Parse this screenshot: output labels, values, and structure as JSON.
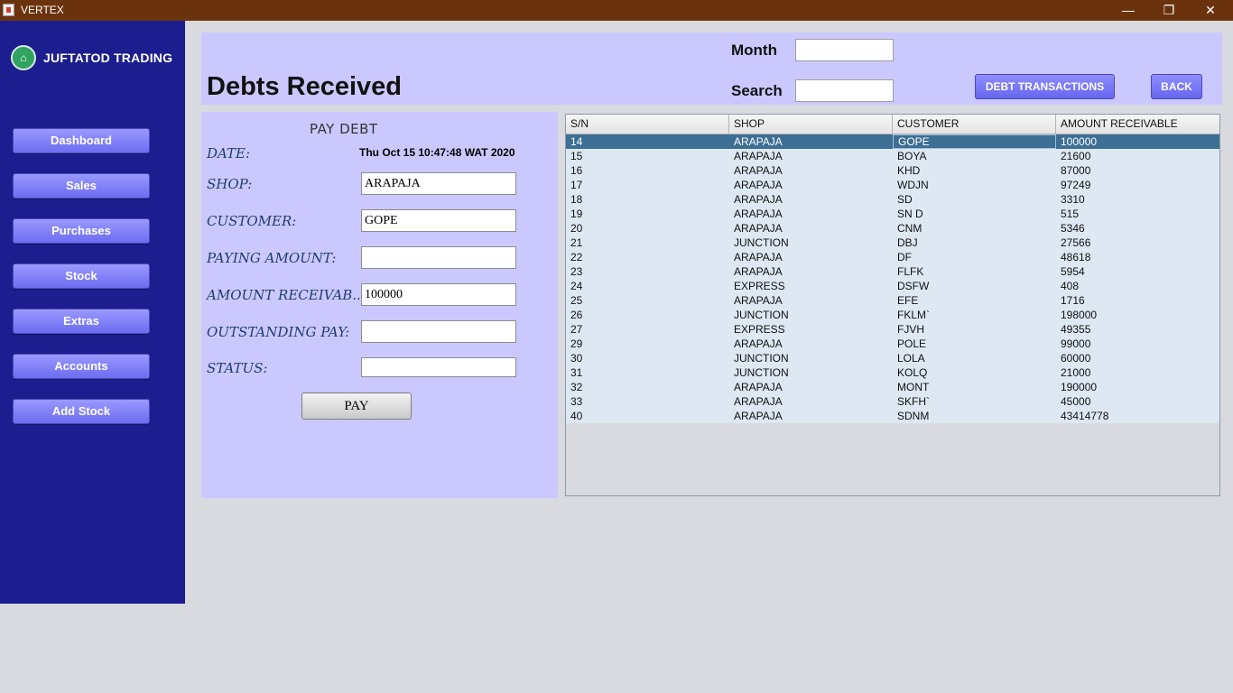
{
  "window": {
    "title": "VERTEX",
    "controls": {
      "minimize": "—",
      "restore": "❐",
      "close": "✕"
    }
  },
  "sidebar": {
    "brand": "JUFTATOD TRADING",
    "nav": [
      "Dashboard",
      "Sales",
      "Purchases",
      "Stock",
      "Extras",
      "Accounts",
      "Add Stock"
    ]
  },
  "header": {
    "title": "Debts Received",
    "month_label": "Month",
    "search_label": "Search",
    "month_value": "",
    "search_value": "",
    "debt_transactions_btn": "DEBT TRANSACTIONS",
    "back_btn": "BACK"
  },
  "form": {
    "title": "PAY DEBT",
    "date_label": "DATE:",
    "date_value": "Thu Oct 15 10:47:48 WAT 2020",
    "shop_label": "SHOP:",
    "shop_value": "ARAPAJA",
    "customer_label": "CUSTOMER:",
    "customer_value": "GOPE",
    "paying_label": "PAYING AMOUNT:",
    "paying_value": "",
    "receivable_label": "AMOUNT RECEIVAB...",
    "receivable_value": "100000",
    "outstanding_label": "OUTSTANDING PAY:",
    "outstanding_value": "",
    "status_label": "STATUS:",
    "status_value": "",
    "pay_btn": "PAY"
  },
  "table": {
    "columns": [
      "S/N",
      "SHOP",
      "CUSTOMER",
      "AMOUNT RECEIVABLE"
    ],
    "selected_row": 0,
    "rows": [
      [
        "14",
        "ARAPAJA",
        "GOPE",
        "100000"
      ],
      [
        "15",
        "ARAPAJA",
        "BOYA",
        "21600"
      ],
      [
        "16",
        "ARAPAJA",
        "KHD",
        "87000"
      ],
      [
        "17",
        "ARAPAJA",
        "WDJN",
        "97249"
      ],
      [
        "18",
        "ARAPAJA",
        "SD",
        "3310"
      ],
      [
        "19",
        "ARAPAJA",
        "SN D",
        "515"
      ],
      [
        "20",
        "ARAPAJA",
        "CNM",
        "5346"
      ],
      [
        "21",
        "JUNCTION",
        "DBJ",
        "27566"
      ],
      [
        "22",
        "ARAPAJA",
        "DF",
        "48618"
      ],
      [
        "23",
        "ARAPAJA",
        "FLFK",
        "5954"
      ],
      [
        "24",
        "EXPRESS",
        "DSFW",
        "408"
      ],
      [
        "25",
        "ARAPAJA",
        "EFE",
        "1716"
      ],
      [
        "26",
        "JUNCTION",
        "FKLM`",
        "198000"
      ],
      [
        "27",
        "EXPRESS",
        "FJVH",
        "49355"
      ],
      [
        "29",
        "ARAPAJA",
        "POLE",
        "99000"
      ],
      [
        "30",
        "JUNCTION",
        "LOLA",
        "60000"
      ],
      [
        "31",
        "JUNCTION",
        "KOLQ",
        "21000"
      ],
      [
        "32",
        "ARAPAJA",
        "MONT",
        "190000"
      ],
      [
        "33",
        "ARAPAJA",
        "SKFH`",
        "45000"
      ],
      [
        "40",
        "ARAPAJA",
        "SDNM",
        "43414778"
      ]
    ]
  }
}
